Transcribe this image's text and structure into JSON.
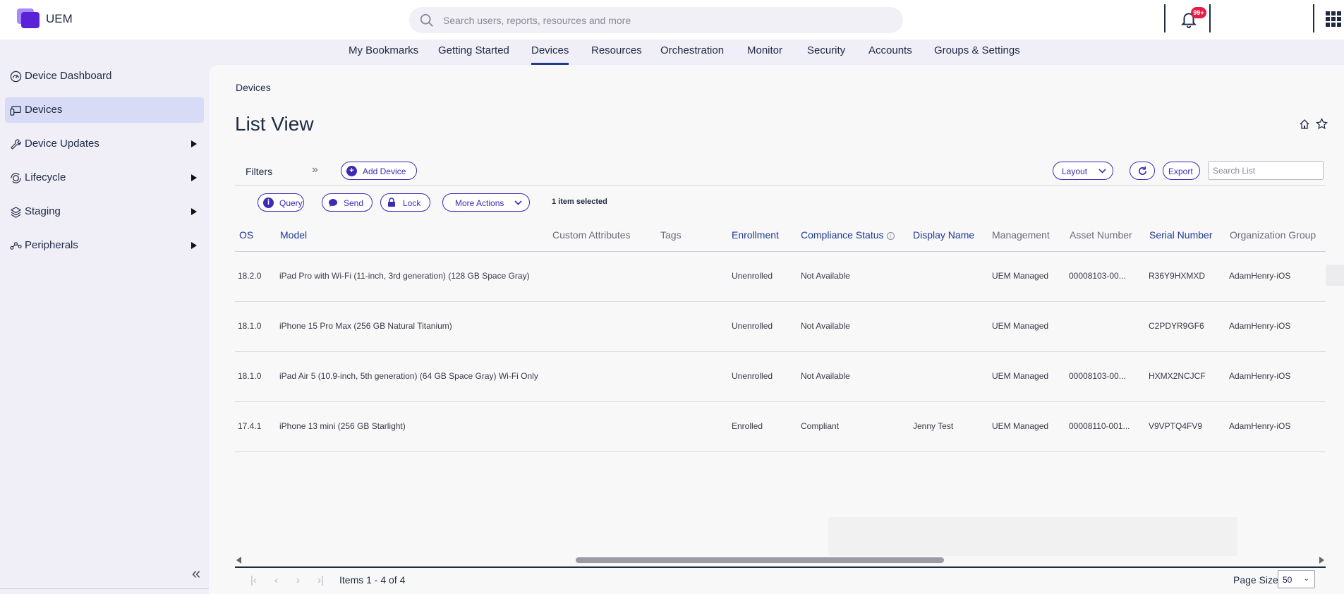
{
  "header": {
    "brand": "UEM",
    "search_placeholder": "Search users, reports, resources and more",
    "notifications_badge": "99+"
  },
  "nav": {
    "items": [
      {
        "label": "My Bookmarks"
      },
      {
        "label": "Getting Started"
      },
      {
        "label": "Devices",
        "active": true
      },
      {
        "label": "Resources"
      },
      {
        "label": "Orchestration"
      },
      {
        "label": "Monitor"
      },
      {
        "label": "Security"
      },
      {
        "label": "Accounts"
      },
      {
        "label": "Groups & Settings"
      }
    ]
  },
  "sidebar": {
    "items": [
      {
        "label": "Device Dashboard",
        "icon": "dashboard-icon"
      },
      {
        "label": "Devices",
        "icon": "devices-icon",
        "active": true
      },
      {
        "label": "Device Updates",
        "icon": "wrench-icon",
        "expandable": true
      },
      {
        "label": "Lifecycle",
        "icon": "lifecycle-icon",
        "expandable": true
      },
      {
        "label": "Staging",
        "icon": "layers-icon",
        "expandable": true
      },
      {
        "label": "Peripherals",
        "icon": "peripherals-icon",
        "expandable": true
      }
    ]
  },
  "main": {
    "breadcrumb": "Devices",
    "title": "List View",
    "filters_label": "Filters",
    "add_device_label": "Add Device",
    "layout_label": "Layout",
    "export_label": "Export",
    "search_list_placeholder": "Search List",
    "actions": {
      "query": "Query",
      "send": "Send",
      "lock": "Lock",
      "more_actions": "More Actions"
    },
    "selected_text": "1 item selected"
  },
  "table": {
    "columns": [
      "OS",
      "Model",
      "Custom Attributes",
      "Tags",
      "Enrollment",
      "Compliance Status",
      "Display Name",
      "Management",
      "Asset Number",
      "Serial Number",
      "Organization Group"
    ],
    "rows": [
      [
        "18.2.0",
        "iPad Pro with Wi-Fi (11-inch, 3rd generation) (128 GB Space Gray)",
        "",
        "",
        "Unenrolled",
        "Not Available",
        "",
        "UEM Managed",
        "00008103-00...",
        "R36Y9HXMXD",
        "AdamHenry-iOS"
      ],
      [
        "18.1.0",
        "iPhone 15 Pro Max (256 GB Natural Titanium)",
        "",
        "",
        "Unenrolled",
        "Not Available",
        "",
        "UEM Managed",
        "",
        "C2PDYR9GF6",
        "AdamHenry-iOS"
      ],
      [
        "18.1.0",
        "iPad Air 5 (10.9-inch, 5th generation) (64 GB Space Gray) Wi-Fi Only",
        "",
        "",
        "Unenrolled",
        "Not Available",
        "",
        "UEM Managed",
        "00008103-00...",
        "HXMX2NCJCF",
        "AdamHenry-iOS"
      ],
      [
        "17.4.1",
        "iPhone 13 mini (256 GB Starlight)",
        "",
        "",
        "Enrolled",
        "Compliant",
        "Jenny Test",
        "UEM Managed",
        "00008110-001...",
        "V9VPTQ4FV9",
        "AdamHenry-iOS"
      ]
    ]
  },
  "footer": {
    "items_text": "Items 1 - 4 of 4",
    "page_size_label": "Page Size:",
    "page_size_value": "50"
  },
  "colors": {
    "accent": "#3b2bb5",
    "navy": "#1f2a44",
    "sidebar_active": "#d7dbf5"
  }
}
